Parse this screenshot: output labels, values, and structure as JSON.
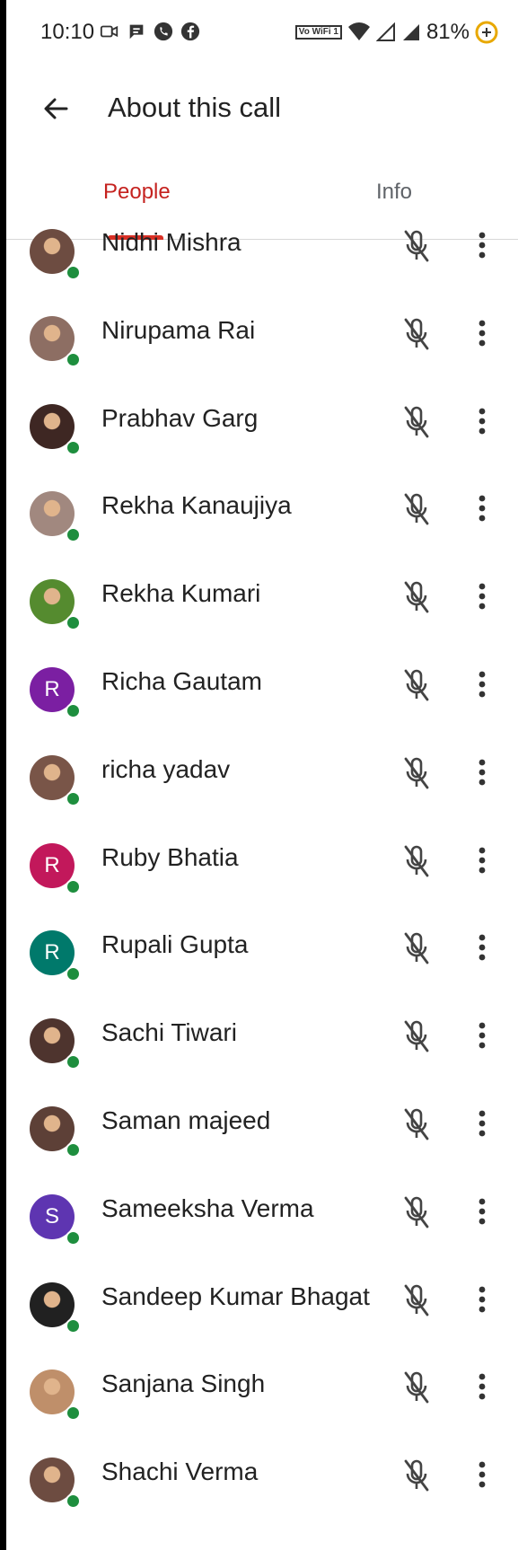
{
  "status_bar": {
    "time": "10:10",
    "left_icons": [
      "video-call-icon",
      "chat-bubble-icon",
      "phone-icon",
      "facebook-icon"
    ],
    "vowifi_label": "Vo WiFi 1",
    "battery": "81%"
  },
  "app_bar": {
    "title": "About this call"
  },
  "tabs": {
    "active": "People",
    "items": [
      "People",
      "Info"
    ]
  },
  "colors": {
    "accent": "#d93025",
    "online": "#1e8e3e"
  },
  "participants": [
    {
      "name": "Nidhi Mishra",
      "avatar": "photo",
      "online": true
    },
    {
      "name": "Nirupama Rai",
      "avatar": "photo",
      "online": true
    },
    {
      "name": "Prabhav Garg",
      "avatar": "photo",
      "online": true
    },
    {
      "name": "Rekha Kanaujiya",
      "avatar": "photo",
      "online": true
    },
    {
      "name": "Rekha Kumari",
      "avatar": "photo",
      "online": true
    },
    {
      "name": "Richa Gautam",
      "avatar": "letter",
      "letter": "R",
      "color": "#7b1fa2",
      "online": true
    },
    {
      "name": "richa yadav",
      "avatar": "photo",
      "online": true
    },
    {
      "name": "Ruby Bhatia",
      "avatar": "letter",
      "letter": "R",
      "color": "#c2185b",
      "online": true
    },
    {
      "name": "Rupali Gupta",
      "avatar": "letter",
      "letter": "R",
      "color": "#00796b",
      "online": true
    },
    {
      "name": "Sachi Tiwari",
      "avatar": "photo",
      "online": true
    },
    {
      "name": "Saman majeed",
      "avatar": "photo",
      "online": true
    },
    {
      "name": "Sameeksha Verma",
      "avatar": "letter",
      "letter": "S",
      "color": "#5e35b1",
      "online": true
    },
    {
      "name": "Sandeep Kumar Bhagat",
      "avatar": "photo",
      "online": true
    },
    {
      "name": "Sanjana Singh",
      "avatar": "photo",
      "online": true
    },
    {
      "name": "Shachi Verma",
      "avatar": "photo",
      "online": true
    }
  ]
}
